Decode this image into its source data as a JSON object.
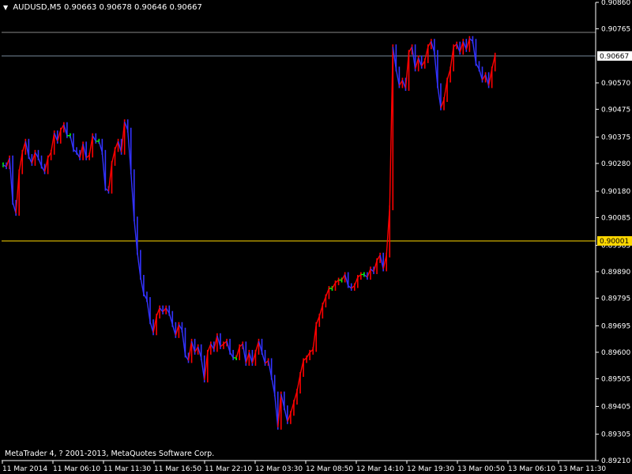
{
  "header": {
    "symbol_timeframe": "AUDUSD,M5",
    "ohlc": "0.90663 0.90678 0.90646 0.90667",
    "menu_icon": "triangle-down-icon"
  },
  "footer": {
    "copyright": "MetaTrader 4, ? 2001-2013, MetaQuotes Software Corp."
  },
  "colors": {
    "background": "#000000",
    "axis": "#ffffff",
    "candle_up": "#ff0000",
    "candle_down": "#3333ff",
    "candle_doji": "#00ff00",
    "bid_line": "#778899",
    "ask_line": "#888888",
    "level_line": "#ffd700"
  },
  "chart_data": {
    "type": "line",
    "symbol": "AUDUSD",
    "timeframe": "M5",
    "ylim": [
      0.8921,
      0.9086
    ],
    "y_ticks": [
      "0.90860",
      "0.90765",
      "0.90570",
      "0.90475",
      "0.90375",
      "0.90280",
      "0.90180",
      "0.90085",
      "0.89985",
      "0.89890",
      "0.89795",
      "0.89695",
      "0.89600",
      "0.89505",
      "0.89405",
      "0.89305",
      "0.89210"
    ],
    "x_ticks": [
      "11 Mar 2014",
      "11 Mar 06:10",
      "11 Mar 11:30",
      "11 Mar 16:50",
      "11 Mar 22:10",
      "12 Mar 03:30",
      "12 Mar 08:50",
      "12 Mar 14:10",
      "12 Mar 19:30",
      "13 Mar 00:50",
      "13 Mar 06:10",
      "13 Mar 11:30"
    ],
    "current_price": {
      "label": "0.90667",
      "value": 0.90667
    },
    "level_line": {
      "label": "0.90001",
      "value": 0.90001
    },
    "ask_line": {
      "value": 0.90752
    },
    "series": [
      {
        "x": [
          0,
          4,
          8,
          12,
          16,
          20,
          24,
          28,
          32,
          36,
          40,
          44,
          48,
          52,
          56,
          60,
          64,
          68,
          72,
          76,
          80,
          84,
          88,
          92,
          96,
          100,
          104,
          108,
          112,
          116,
          120,
          124,
          128,
          132,
          136,
          140,
          144,
          148,
          152,
          156,
          160,
          164,
          168,
          172,
          176,
          180,
          184,
          188,
          192,
          196,
          200,
          204,
          208,
          212,
          216,
          220,
          224,
          228,
          232,
          236,
          240,
          244,
          248,
          252,
          256,
          260,
          264,
          268,
          272,
          276,
          280,
          284,
          288,
          292,
          296,
          300,
          304,
          308,
          312,
          316,
          320,
          324,
          328,
          332,
          336,
          340,
          344,
          348,
          352,
          356,
          360,
          364,
          368,
          372,
          376,
          380,
          384,
          388,
          392,
          396,
          400,
          404,
          408,
          412,
          416,
          420,
          424,
          428,
          432,
          436,
          440,
          444,
          448,
          452,
          456,
          460,
          464,
          468,
          472,
          476,
          480,
          484,
          488,
          492,
          496,
          500,
          504,
          508,
          512,
          516,
          520,
          524,
          528,
          532,
          536,
          540,
          544,
          548,
          552,
          556,
          560,
          564,
          568,
          572,
          576,
          580,
          584,
          588,
          592,
          596,
          600,
          604,
          608,
          612,
          616,
          620,
          624,
          628,
          632,
          636,
          640,
          644,
          648,
          652,
          656,
          660,
          664,
          668,
          672,
          676,
          680,
          684,
          688,
          692,
          696,
          700,
          704,
          708,
          712,
          716,
          720,
          724,
          728,
          732,
          736
        ],
        "close": [
          0.90275,
          0.90268,
          0.903,
          0.9014,
          0.901,
          0.9025,
          0.9032,
          0.9036,
          0.90305,
          0.9028,
          0.9032,
          0.903,
          0.9027,
          0.9025,
          0.903,
          0.9032,
          0.9039,
          0.9036,
          0.904,
          0.9042,
          0.9038,
          0.9038,
          0.9033,
          0.9032,
          0.903,
          0.9035,
          0.903,
          0.9031,
          0.9038,
          0.9036,
          0.9036,
          0.9032,
          0.9019,
          0.9018,
          0.9028,
          0.9033,
          0.9036,
          0.9032,
          0.9043,
          0.904,
          0.9025,
          0.9008,
          0.8996,
          0.8987,
          0.8981,
          0.8979,
          0.8971,
          0.8967,
          0.8973,
          0.8976,
          0.89745,
          0.8976,
          0.8974,
          0.897,
          0.8966,
          0.897,
          0.8968,
          0.8959,
          0.8957,
          0.8964,
          0.896,
          0.8962,
          0.8958,
          0.895,
          0.896,
          0.8963,
          0.8961,
          0.8966,
          0.8962,
          0.8963,
          0.8964,
          0.896,
          0.8958,
          0.8958,
          0.8962,
          0.8963,
          0.8956,
          0.896,
          0.8956,
          0.896,
          0.8964,
          0.896,
          0.8956,
          0.8957,
          0.8951,
          0.8945,
          0.8933,
          0.8945,
          0.894,
          0.8935,
          0.8938,
          0.8942,
          0.8946,
          0.8952,
          0.8957,
          0.8958,
          0.896,
          0.8961,
          0.897,
          0.8973,
          0.8977,
          0.898,
          0.8983,
          0.8983,
          0.8985,
          0.8986,
          0.8986,
          0.8988,
          0.8984,
          0.8983,
          0.8984,
          0.8987,
          0.8988,
          0.8988,
          0.8987,
          0.899,
          0.8989,
          0.8993,
          0.8995,
          0.899,
          0.8995,
          0.9012,
          0.907,
          0.9062,
          0.9056,
          0.9058,
          0.9055,
          0.9068,
          0.907,
          0.9062,
          0.9066,
          0.9063,
          0.9065,
          0.907,
          0.9072,
          0.9068,
          0.9056,
          0.9048,
          0.9051,
          0.9058,
          0.9062,
          0.907,
          0.9071,
          0.9068,
          0.9072,
          0.9069,
          0.9073,
          0.9072,
          0.9064,
          0.9062,
          0.9058,
          0.906,
          0.9056,
          0.9062,
          0.9067
        ]
      }
    ]
  }
}
